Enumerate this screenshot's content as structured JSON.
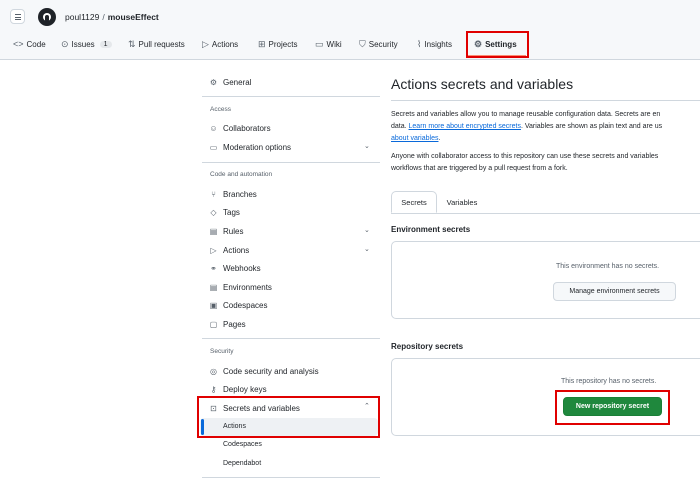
{
  "header": {
    "owner": "poul1129",
    "separator": "/",
    "repo": "mouseEffect"
  },
  "tabs": [
    {
      "label": "Code",
      "icon": "code-icon"
    },
    {
      "label": "Issues",
      "icon": "issue-icon",
      "count": "1"
    },
    {
      "label": "Pull requests",
      "icon": "pull-request-icon"
    },
    {
      "label": "Actions",
      "icon": "play-icon"
    },
    {
      "label": "Projects",
      "icon": "table-icon"
    },
    {
      "label": "Wiki",
      "icon": "book-icon"
    },
    {
      "label": "Security",
      "icon": "shield-icon"
    },
    {
      "label": "Insights",
      "icon": "graph-icon"
    },
    {
      "label": "Settings",
      "icon": "gear-icon",
      "selected": true
    }
  ],
  "sidebar": {
    "general": "General",
    "access_heading": "Access",
    "collaborators": "Collaborators",
    "moderation": "Moderation options",
    "code_heading": "Code and automation",
    "branches": "Branches",
    "tags": "Tags",
    "rules": "Rules",
    "actions": "Actions",
    "webhooks": "Webhooks",
    "environments": "Environments",
    "codespaces": "Codespaces",
    "pages": "Pages",
    "security_heading": "Security",
    "code_security": "Code security and analysis",
    "deploy_keys": "Deploy keys",
    "secrets": "Secrets and variables",
    "sub_actions": "Actions",
    "sub_codespaces": "Codespaces",
    "sub_dependabot": "Dependabot"
  },
  "main": {
    "title": "Actions secrets and variables",
    "p1_line1": "Secrets and variables allow you to manage reusable configuration data. Secrets are en",
    "p1_line2_pre": "data. ",
    "p1_link1": "Learn more about encrypted secrets",
    "p1_line2_post": ". Variables are shown as plain text and are us",
    "p1_link2": "about variables",
    "p1_line3_post": ".",
    "p2_line1": "Anyone with collaborator access to this repository can use these secrets and variables",
    "p2_line2": "workflows that are triggered by a pull request from a fork.",
    "tab_secrets": "Secrets",
    "tab_variables": "Variables",
    "env_title": "Environment secrets",
    "env_empty": "This environment has no secrets.",
    "env_button": "Manage environment secrets",
    "repo_title": "Repository secrets",
    "repo_empty": "This repository has no secrets.",
    "repo_button": "New repository secret"
  },
  "colors": {
    "highlight": "#e00000",
    "primary_button": "#1f883d",
    "link": "#0969da",
    "tab_underline": "#fd8c73"
  }
}
